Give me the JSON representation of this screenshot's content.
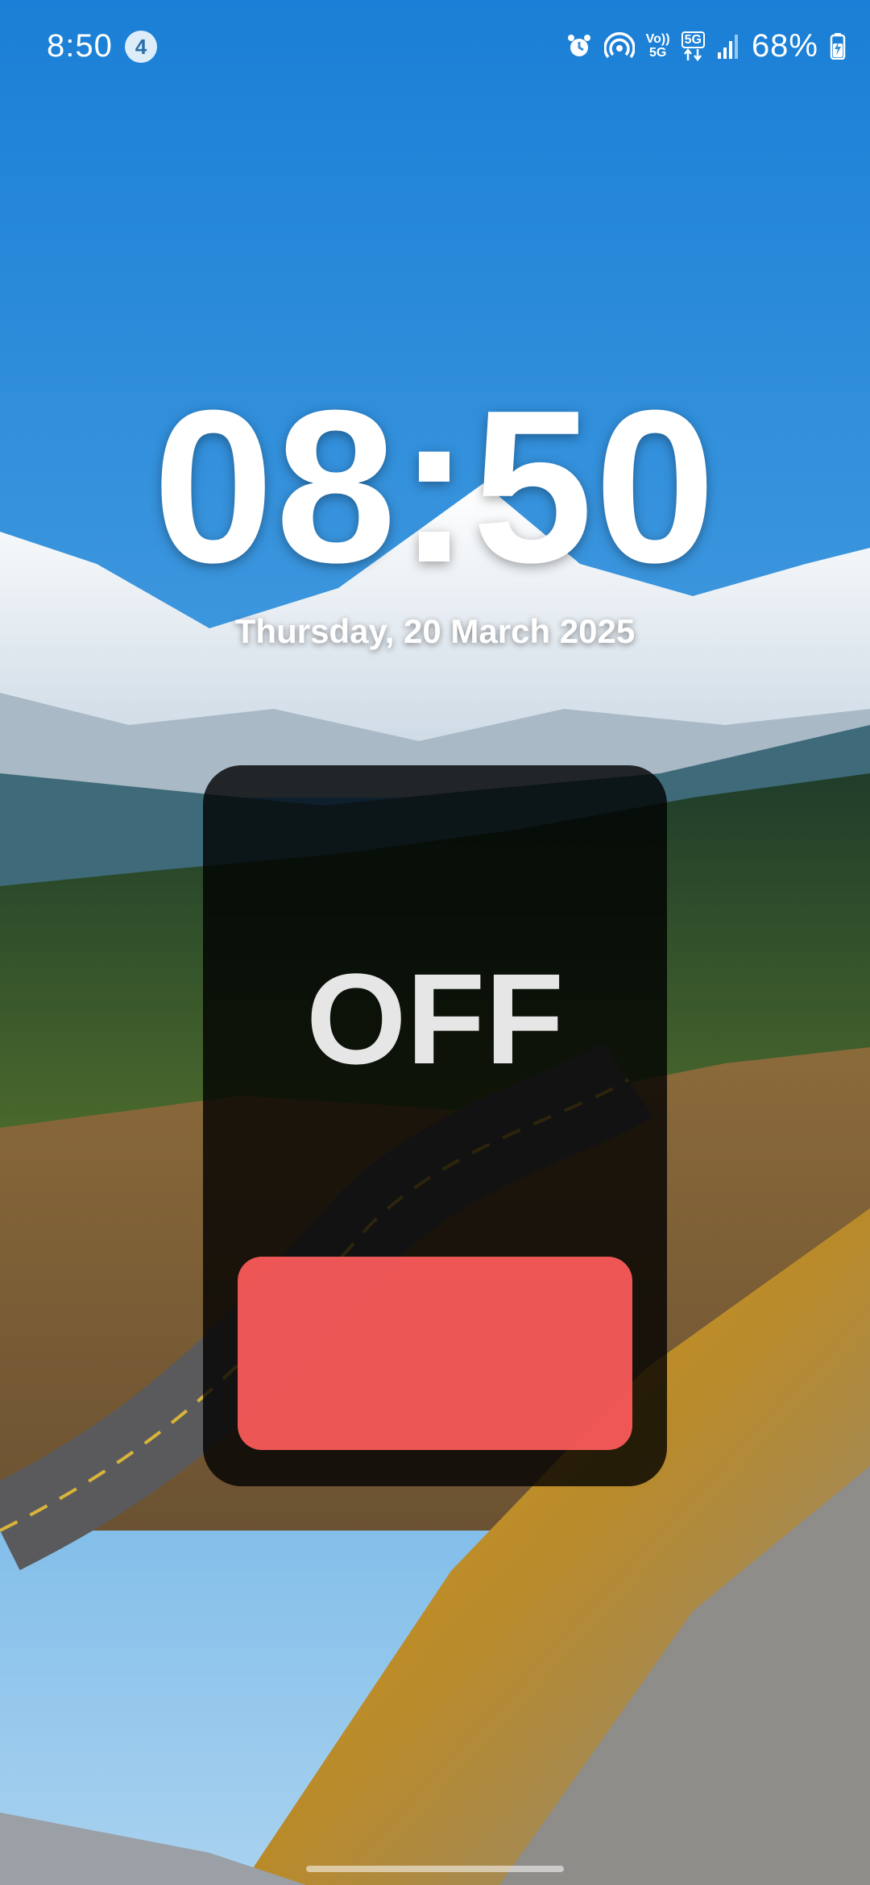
{
  "status_bar": {
    "time": "8:50",
    "notification_count": "4",
    "icons": [
      "alarm-icon",
      "hotspot-icon",
      "volte-5g-icon",
      "5g-data-icon",
      "signal-icon"
    ],
    "volte_label_top": "Vo))",
    "volte_label_bottom": "5G",
    "network_label": "5G",
    "battery_percent": "68%",
    "battery_level": 0.68,
    "charging": true
  },
  "lock_screen": {
    "clock": "08:50",
    "date": "Thursday, 20 March 2025"
  },
  "widget": {
    "state_label": "OFF",
    "toggle_color": "#ff5c5c",
    "background": "#000000"
  },
  "colors": {
    "sky": "#2f8fd8",
    "text": "#ffffff"
  }
}
